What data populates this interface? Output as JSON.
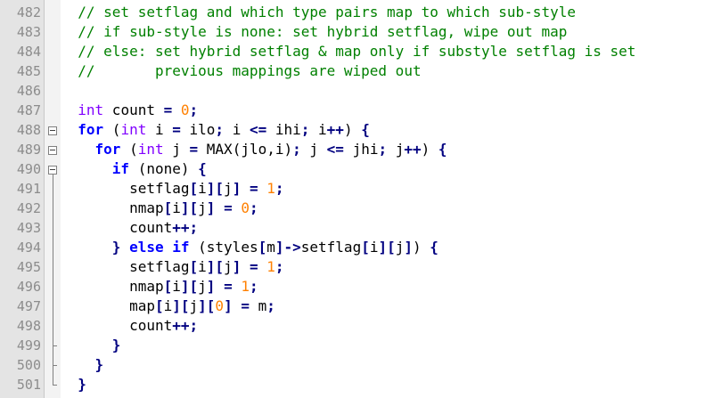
{
  "editor": {
    "lines": [
      {
        "n": "482",
        "tokens": [
          {
            "t": "  "
          },
          {
            "t": "// set setflag and which type pairs map to which sub-style",
            "c": "cm"
          }
        ]
      },
      {
        "n": "483",
        "tokens": [
          {
            "t": "  "
          },
          {
            "t": "// if sub-style is none: set hybrid setflag, wipe out map",
            "c": "cm"
          }
        ]
      },
      {
        "n": "484",
        "tokens": [
          {
            "t": "  "
          },
          {
            "t": "// else: set hybrid setflag & map only if substyle setflag is set",
            "c": "cm"
          }
        ]
      },
      {
        "n": "485",
        "tokens": [
          {
            "t": "  "
          },
          {
            "t": "//       previous mappings are wiped out",
            "c": "cm"
          }
        ]
      },
      {
        "n": "486",
        "tokens": []
      },
      {
        "n": "487",
        "tokens": [
          {
            "t": "  "
          },
          {
            "t": "int",
            "c": "ty"
          },
          {
            "t": " count "
          },
          {
            "t": "=",
            "c": "op"
          },
          {
            "t": " "
          },
          {
            "t": "0",
            "c": "num"
          },
          {
            "t": ";",
            "c": "op"
          }
        ]
      },
      {
        "n": "488",
        "tokens": [
          {
            "t": "  "
          },
          {
            "t": "for",
            "c": "kw"
          },
          {
            "t": " ("
          },
          {
            "t": "int",
            "c": "ty"
          },
          {
            "t": " i "
          },
          {
            "t": "=",
            "c": "op"
          },
          {
            "t": " ilo"
          },
          {
            "t": ";",
            "c": "op"
          },
          {
            "t": " i "
          },
          {
            "t": "<=",
            "c": "op"
          },
          {
            "t": " ihi"
          },
          {
            "t": ";",
            "c": "op"
          },
          {
            "t": " i"
          },
          {
            "t": "++",
            "c": "op"
          },
          {
            "t": ") "
          },
          {
            "t": "{",
            "c": "op"
          }
        ]
      },
      {
        "n": "489",
        "tokens": [
          {
            "t": "    "
          },
          {
            "t": "for",
            "c": "kw"
          },
          {
            "t": " ("
          },
          {
            "t": "int",
            "c": "ty"
          },
          {
            "t": " j "
          },
          {
            "t": "=",
            "c": "op"
          },
          {
            "t": " MAX(jlo,i)"
          },
          {
            "t": ";",
            "c": "op"
          },
          {
            "t": " j "
          },
          {
            "t": "<=",
            "c": "op"
          },
          {
            "t": " jhi"
          },
          {
            "t": ";",
            "c": "op"
          },
          {
            "t": " j"
          },
          {
            "t": "++",
            "c": "op"
          },
          {
            "t": ") "
          },
          {
            "t": "{",
            "c": "op"
          }
        ]
      },
      {
        "n": "490",
        "tokens": [
          {
            "t": "      "
          },
          {
            "t": "if",
            "c": "kw"
          },
          {
            "t": " (none) "
          },
          {
            "t": "{",
            "c": "op"
          }
        ]
      },
      {
        "n": "491",
        "tokens": [
          {
            "t": "        setflag"
          },
          {
            "t": "[",
            "c": "op"
          },
          {
            "t": "i"
          },
          {
            "t": "][",
            "c": "op"
          },
          {
            "t": "j"
          },
          {
            "t": "]",
            "c": "op"
          },
          {
            "t": " "
          },
          {
            "t": "=",
            "c": "op"
          },
          {
            "t": " "
          },
          {
            "t": "1",
            "c": "num"
          },
          {
            "t": ";",
            "c": "op"
          }
        ]
      },
      {
        "n": "492",
        "tokens": [
          {
            "t": "        nmap"
          },
          {
            "t": "[",
            "c": "op"
          },
          {
            "t": "i"
          },
          {
            "t": "][",
            "c": "op"
          },
          {
            "t": "j"
          },
          {
            "t": "]",
            "c": "op"
          },
          {
            "t": " "
          },
          {
            "t": "=",
            "c": "op"
          },
          {
            "t": " "
          },
          {
            "t": "0",
            "c": "num"
          },
          {
            "t": ";",
            "c": "op"
          }
        ]
      },
      {
        "n": "493",
        "tokens": [
          {
            "t": "        count"
          },
          {
            "t": "++;",
            "c": "op"
          }
        ]
      },
      {
        "n": "494",
        "tokens": [
          {
            "t": "      "
          },
          {
            "t": "}",
            "c": "op"
          },
          {
            "t": " "
          },
          {
            "t": "else",
            "c": "kw"
          },
          {
            "t": " "
          },
          {
            "t": "if",
            "c": "kw"
          },
          {
            "t": " (styles"
          },
          {
            "t": "[",
            "c": "op"
          },
          {
            "t": "m"
          },
          {
            "t": "]->",
            "c": "op"
          },
          {
            "t": "setflag"
          },
          {
            "t": "[",
            "c": "op"
          },
          {
            "t": "i"
          },
          {
            "t": "][",
            "c": "op"
          },
          {
            "t": "j"
          },
          {
            "t": "]",
            "c": "op"
          },
          {
            "t": ") "
          },
          {
            "t": "{",
            "c": "op"
          }
        ]
      },
      {
        "n": "495",
        "tokens": [
          {
            "t": "        setflag"
          },
          {
            "t": "[",
            "c": "op"
          },
          {
            "t": "i"
          },
          {
            "t": "][",
            "c": "op"
          },
          {
            "t": "j"
          },
          {
            "t": "]",
            "c": "op"
          },
          {
            "t": " "
          },
          {
            "t": "=",
            "c": "op"
          },
          {
            "t": " "
          },
          {
            "t": "1",
            "c": "num"
          },
          {
            "t": ";",
            "c": "op"
          }
        ]
      },
      {
        "n": "496",
        "tokens": [
          {
            "t": "        nmap"
          },
          {
            "t": "[",
            "c": "op"
          },
          {
            "t": "i"
          },
          {
            "t": "][",
            "c": "op"
          },
          {
            "t": "j"
          },
          {
            "t": "]",
            "c": "op"
          },
          {
            "t": " "
          },
          {
            "t": "=",
            "c": "op"
          },
          {
            "t": " "
          },
          {
            "t": "1",
            "c": "num"
          },
          {
            "t": ";",
            "c": "op"
          }
        ]
      },
      {
        "n": "497",
        "tokens": [
          {
            "t": "        map"
          },
          {
            "t": "[",
            "c": "op"
          },
          {
            "t": "i"
          },
          {
            "t": "][",
            "c": "op"
          },
          {
            "t": "j"
          },
          {
            "t": "][",
            "c": "op"
          },
          {
            "t": "0",
            "c": "num"
          },
          {
            "t": "]",
            "c": "op"
          },
          {
            "t": " "
          },
          {
            "t": "=",
            "c": "op"
          },
          {
            "t": " m"
          },
          {
            "t": ";",
            "c": "op"
          }
        ]
      },
      {
        "n": "498",
        "tokens": [
          {
            "t": "        count"
          },
          {
            "t": "++;",
            "c": "op"
          }
        ]
      },
      {
        "n": "499",
        "tokens": [
          {
            "t": "      "
          },
          {
            "t": "}",
            "c": "op"
          }
        ]
      },
      {
        "n": "500",
        "tokens": [
          {
            "t": "    "
          },
          {
            "t": "}",
            "c": "op"
          }
        ]
      },
      {
        "n": "501",
        "tokens": [
          {
            "t": "  "
          },
          {
            "t": "}",
            "c": "op"
          }
        ]
      }
    ],
    "fold_markers": [
      {
        "line": "488",
        "kind": "open"
      },
      {
        "line": "489",
        "kind": "open"
      },
      {
        "line": "490",
        "kind": "open"
      },
      {
        "line": "499",
        "kind": "end"
      },
      {
        "line": "500",
        "kind": "end"
      },
      {
        "line": "501",
        "kind": "end"
      }
    ],
    "fold_icon": "fold-minus-icon",
    "colors": {
      "keyword": "#0000ff",
      "type": "#8000ff",
      "number": "#ff8000",
      "operator": "#000080",
      "comment": "#008000",
      "line_number": "#8c8c8c",
      "gutter": "#e4e4e4"
    }
  }
}
